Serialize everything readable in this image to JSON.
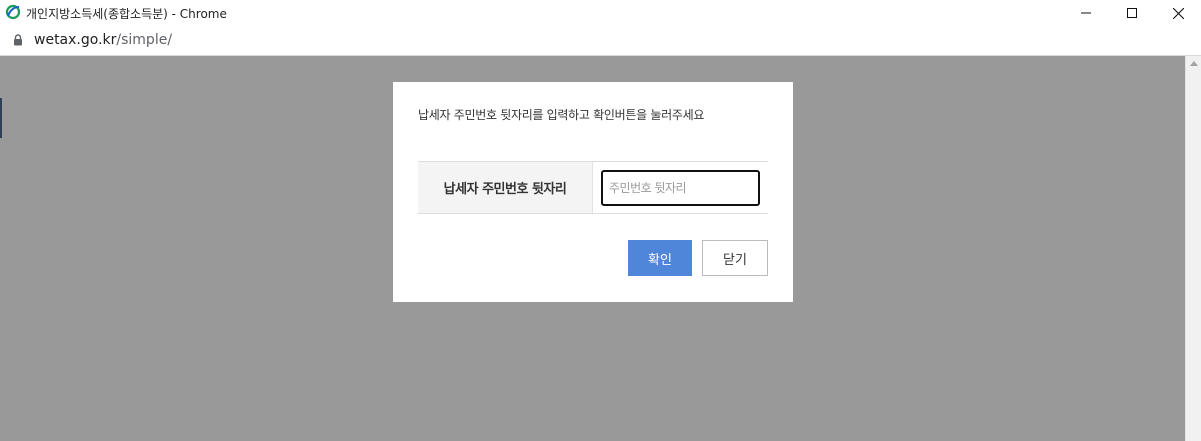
{
  "window": {
    "title": "개인지방소득세(종합소득분) - Chrome",
    "controls": {
      "minimize": "minimize-icon",
      "maximize": "maximize-icon",
      "close": "close-icon"
    }
  },
  "address": {
    "host": "wetax.go.kr",
    "path": "/simple/"
  },
  "modal": {
    "message": "납세자 주민번호 뒷자리를 입력하고 확인버튼을 눌러주세요",
    "field_label": "납세자 주민번호 뒷자리",
    "input_placeholder": "주민번호 뒷자리",
    "input_value": "",
    "confirm_label": "확인",
    "close_label": "닫기"
  },
  "colors": {
    "overlay": "#999999",
    "confirm_button": "#4f86d9",
    "label_bg": "#f4f4f4"
  }
}
